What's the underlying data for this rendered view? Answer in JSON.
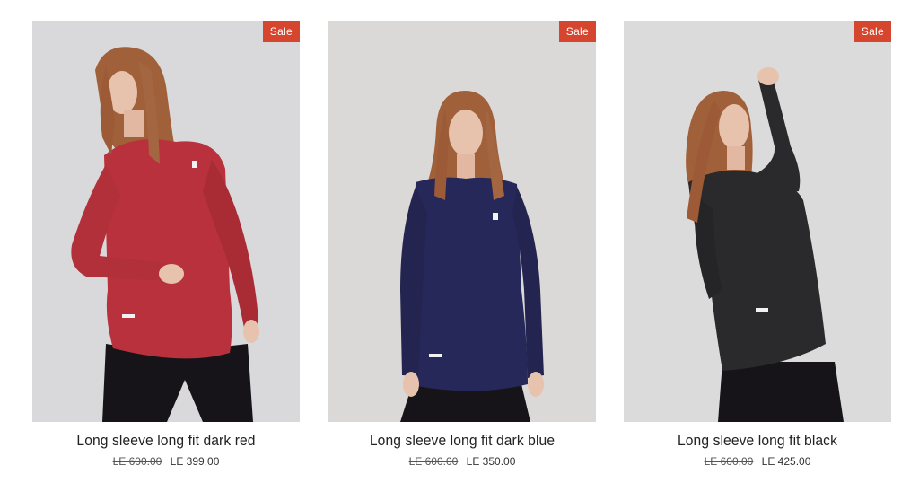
{
  "products": [
    {
      "title": "Long sleeve long fit dark red",
      "badge": "Sale",
      "old_price": "LE 600.00",
      "price": "LE 399.00",
      "shirt_color": "#b8313c",
      "bg_color": "#d9d9dc"
    },
    {
      "title": "Long sleeve long fit dark blue",
      "badge": "Sale",
      "old_price": "LE 600.00",
      "price": "LE 350.00",
      "shirt_color": "#27285a",
      "bg_color": "#dbd9d8"
    },
    {
      "title": "Long sleeve long fit black",
      "badge": "Sale",
      "old_price": "LE 600.00",
      "price": "LE 425.00",
      "shirt_color": "#2a292c",
      "bg_color": "#dcdbdb"
    }
  ],
  "colors": {
    "sale_badge": "#d6452e",
    "hair": "#a0603a",
    "skin": "#e7c2ad",
    "leggings": "#161418"
  }
}
